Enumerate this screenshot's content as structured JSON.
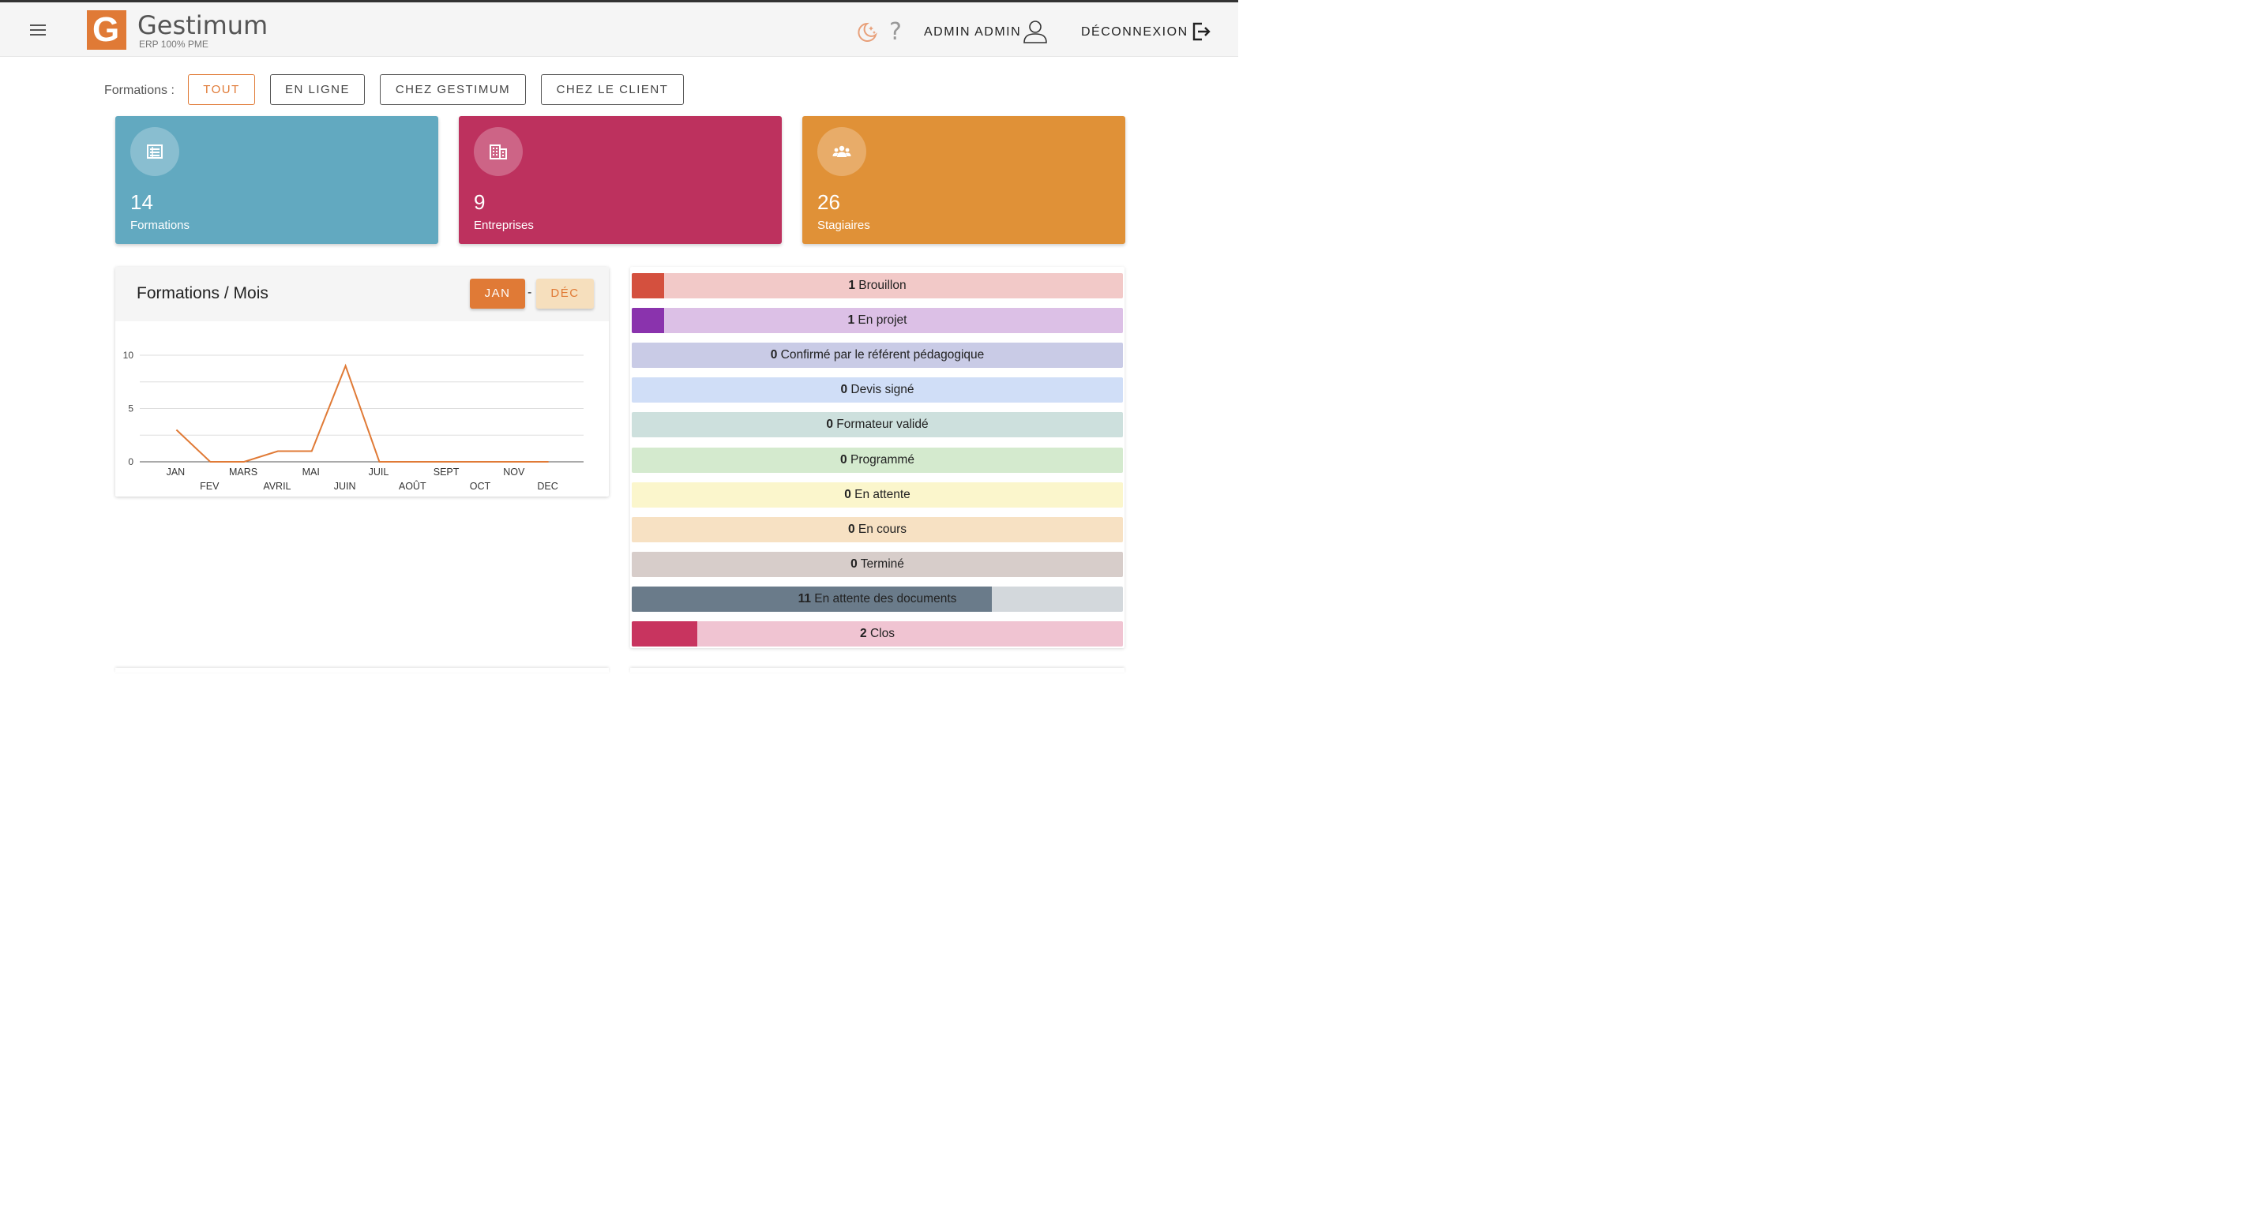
{
  "app": {
    "logo_letter": "G",
    "logo_title": "Gestimum",
    "logo_subtitle": "ERP 100% PME",
    "user_name": "ADMIN ADMIN",
    "logout_label": "DÉCONNEXION",
    "help_label": "?",
    "icons": [
      "menu-icon",
      "moon-stars-icon",
      "help-icon",
      "user-icon",
      "logout-icon"
    ],
    "accent_color": "#e07a36"
  },
  "filters": {
    "label": "Formations :",
    "buttons": [
      "TOUT",
      "EN LIGNE",
      "CHEZ GESTIMUM",
      "CHEZ LE CLIENT"
    ],
    "active": "TOUT"
  },
  "cards": [
    {
      "value": "14",
      "label": "Formations",
      "color": "#62a9c0",
      "icon": "list-icon"
    },
    {
      "value": "9",
      "label": "Entreprises",
      "color": "#bd315e",
      "icon": "building-icon"
    },
    {
      "value": "26",
      "label": "Stagiaires",
      "color": "#e09137",
      "icon": "group-icon"
    }
  ],
  "chart": {
    "title": "Formations / Mois",
    "range_start": "JAN",
    "range_separator": "-",
    "range_end": "DÉC"
  },
  "chart_data": {
    "type": "line",
    "title": "Formations / Mois",
    "categories": [
      "JAN",
      "FEV",
      "MARS",
      "AVRIL",
      "MAI",
      "JUIN",
      "JUIL",
      "AOÛT",
      "SEPT",
      "OCT",
      "NOV",
      "DEC"
    ],
    "values": [
      3,
      0,
      0,
      1,
      1,
      9,
      0,
      0,
      0,
      0,
      0,
      0
    ],
    "yticks": [
      0,
      5,
      10
    ],
    "ylim": [
      0,
      10
    ],
    "line_color": "#e07a36",
    "grid": true
  },
  "statuses": [
    {
      "count": "1",
      "label": "Brouillon",
      "ratio": 0.066,
      "bar": "#d4503e",
      "bg": "#f2c9c8"
    },
    {
      "count": "1",
      "label": "En projet",
      "ratio": 0.066,
      "bar": "#8a33ad",
      "bg": "#dcc0e6"
    },
    {
      "count": "0",
      "label": "Confirmé par le référent pédagogique",
      "ratio": 0,
      "bar": "#5b62b0",
      "bg": "#c9cbe6"
    },
    {
      "count": "0",
      "label": "Devis signé",
      "ratio": 0,
      "bar": "#5b8de0",
      "bg": "#d0def7"
    },
    {
      "count": "0",
      "label": "Formateur validé",
      "ratio": 0,
      "bar": "#5f9b91",
      "bg": "#cde0dd"
    },
    {
      "count": "0",
      "label": "Programmé",
      "ratio": 0,
      "bar": "#6cb56c",
      "bg": "#d4eace"
    },
    {
      "count": "0",
      "label": "En attente",
      "ratio": 0,
      "bar": "#e6d84c",
      "bg": "#fbf6cc"
    },
    {
      "count": "0",
      "label": "En cours",
      "ratio": 0,
      "bar": "#e8a85c",
      "bg": "#f7e1c3"
    },
    {
      "count": "0",
      "label": "Terminé",
      "ratio": 0,
      "bar": "#8a7270",
      "bg": "#d7cdca"
    },
    {
      "count": "11",
      "label": "En attente des documents",
      "ratio": 0.733,
      "bar": "#6a7b8a",
      "bg": "#d3d8dc"
    },
    {
      "count": "2",
      "label": "Clos",
      "ratio": 0.133,
      "bar": "#c8345f",
      "bg": "#f0c4d2"
    }
  ]
}
